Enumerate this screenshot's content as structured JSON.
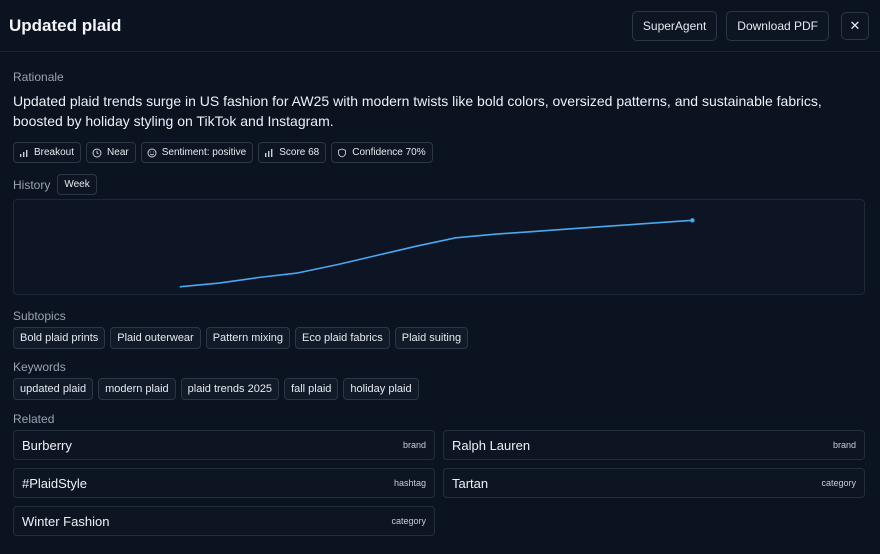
{
  "header": {
    "title": "Updated plaid",
    "superagent_label": "SuperAgent",
    "download_label": "Download PDF",
    "close_glyph": "✕"
  },
  "rationale": {
    "label": "Rationale",
    "text": "Updated plaid trends surge in US fashion for AW25 with modern twists like bold colors, oversized patterns, and sustainable fabrics, boosted by holiday styling on TikTok and Instagram."
  },
  "badges": [
    {
      "label": "Breakout",
      "icon": "bar-chart-icon"
    },
    {
      "label": "Near",
      "icon": "clock-icon"
    },
    {
      "label": "Sentiment: positive",
      "icon": "smile-icon"
    },
    {
      "label": "Score 68",
      "icon": "bar-chart-icon"
    },
    {
      "label": "Confidence 70%",
      "icon": "shield-icon"
    }
  ],
  "history": {
    "label": "History",
    "range_label": "Week"
  },
  "chart_data": {
    "type": "line",
    "title": "",
    "xlabel": "",
    "ylabel": "",
    "x": [
      1,
      2,
      3,
      4,
      5,
      6,
      7,
      8,
      9,
      10,
      11,
      12,
      13,
      14
    ],
    "series": [
      {
        "values": [
          10,
          14,
          20,
          25,
          34,
          44,
          54,
          63,
          67,
          70,
          73,
          76,
          79,
          82
        ]
      }
    ],
    "xlim": [
      -3.2,
      18.4
    ],
    "ylim": [
      0,
      104
    ],
    "grid": false,
    "line_color": "#4aa8f0"
  },
  "subtopics": {
    "label": "Subtopics",
    "items": [
      "Bold plaid prints",
      "Plaid outerwear",
      "Pattern mixing",
      "Eco plaid fabrics",
      "Plaid suiting"
    ]
  },
  "keywords": {
    "label": "Keywords",
    "items": [
      "updated plaid",
      "modern plaid",
      "plaid trends 2025",
      "fall plaid",
      "holiday plaid"
    ]
  },
  "related": {
    "label": "Related",
    "items": [
      {
        "name": "Burberry",
        "type": "brand"
      },
      {
        "name": "Ralph Lauren",
        "type": "brand"
      },
      {
        "name": "#PlaidStyle",
        "type": "hashtag"
      },
      {
        "name": "Tartan",
        "type": "category"
      },
      {
        "name": "Winter Fashion",
        "type": "category"
      }
    ]
  }
}
